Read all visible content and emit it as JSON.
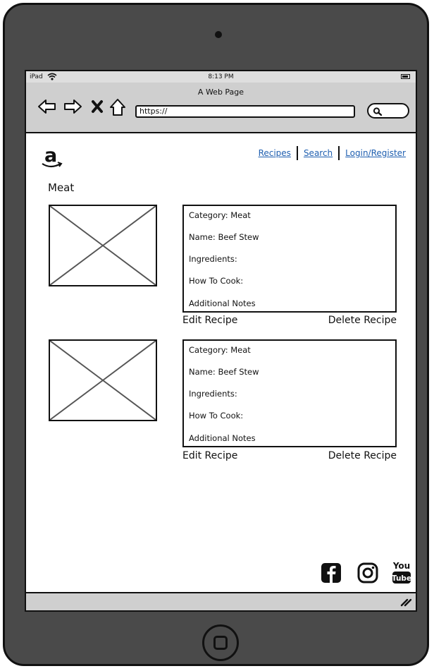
{
  "status": {
    "carrier": "iPad",
    "time": "8:13 PM"
  },
  "browser": {
    "title": "A Web Page",
    "url": "https://"
  },
  "nav": {
    "recipes": "Recipes",
    "search": "Search",
    "login": "Login/Register"
  },
  "section": {
    "heading": "Meat"
  },
  "recipes": [
    {
      "category": "Category: Meat",
      "name": "Name: Beef Stew",
      "ingredients": "Ingredients:",
      "how_to_cook": "How To Cook:",
      "notes": "Additional Notes",
      "edit": "Edit Recipe",
      "delete": "Delete Recipe"
    },
    {
      "category": "Category: Meat",
      "name": "Name: Beef Stew",
      "ingredients": "Ingredients:",
      "how_to_cook": "How To Cook:",
      "notes": "Additional Notes",
      "edit": "Edit Recipe",
      "delete": "Delete Recipe"
    }
  ],
  "social": {
    "youtube_you": "You",
    "youtube_tube": "Tube"
  },
  "icons": [
    "wifi-icon",
    "battery-icon",
    "back-icon",
    "forward-icon",
    "stop-icon",
    "home-icon",
    "search-icon",
    "amazon-logo",
    "facebook-icon",
    "instagram-icon",
    "youtube-icon",
    "resize-grip-icon"
  ],
  "colors": {
    "device": "#4a4a4a",
    "chrome": "#cfcfcf",
    "link": "#1f5fb0",
    "screen": "#ffffff"
  }
}
